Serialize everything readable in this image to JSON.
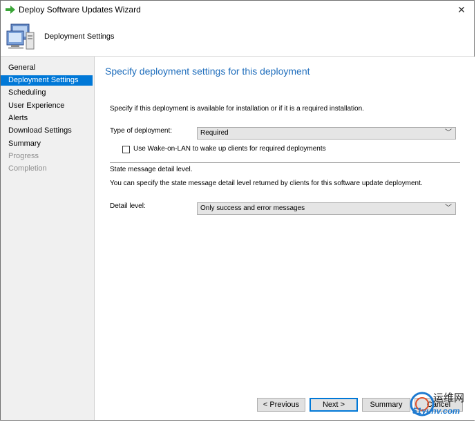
{
  "window": {
    "title": "Deploy Software Updates Wizard"
  },
  "header": {
    "title": "Deployment Settings"
  },
  "sidebar": {
    "items": [
      {
        "label": "General",
        "state": "normal"
      },
      {
        "label": "Deployment Settings",
        "state": "active"
      },
      {
        "label": "Scheduling",
        "state": "normal"
      },
      {
        "label": "User Experience",
        "state": "normal"
      },
      {
        "label": "Alerts",
        "state": "normal"
      },
      {
        "label": "Download Settings",
        "state": "normal"
      },
      {
        "label": "Summary",
        "state": "normal"
      },
      {
        "label": "Progress",
        "state": "disabled"
      },
      {
        "label": "Completion",
        "state": "disabled"
      }
    ]
  },
  "main": {
    "title": "Specify deployment settings for this deployment",
    "description": "Specify if this deployment is available for installation or if it is a required installation.",
    "deployment_type": {
      "label": "Type of deployment:",
      "value": "Required"
    },
    "wake_on_lan": {
      "label": "Use Wake-on-LAN to wake up clients for required deployments",
      "checked": false
    },
    "state_message": {
      "heading": "State message detail level.",
      "description": "You can specify the state message detail level returned by clients for this software update deployment."
    },
    "detail_level": {
      "label": "Detail level:",
      "value": "Only success and error messages"
    }
  },
  "buttons": {
    "previous": "< Previous",
    "next": "Next >",
    "summary": "Summary",
    "cancel": "Cancel"
  },
  "watermark": {
    "line1": "运维网",
    "line2": "51yunv.com"
  },
  "colors": {
    "accent": "#0078d7",
    "title_blue": "#1e6dbc",
    "arrow_green": "#3aa537"
  }
}
